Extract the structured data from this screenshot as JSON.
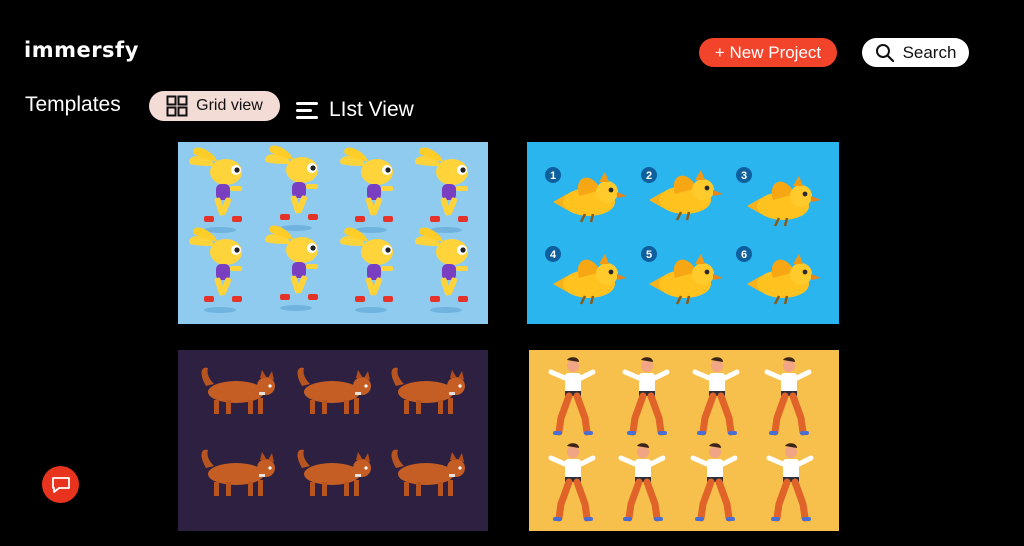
{
  "header": {
    "logo_text": "immersfy",
    "new_project_label": "+ New Project",
    "search_label": "Search"
  },
  "toolbar": {
    "section_title": "Templates",
    "grid_view_label": "Grid view",
    "list_view_label": "LIst View"
  },
  "templates": [
    {
      "name": "yellow-rabbit-run-cycle",
      "background": "#8ecbef"
    },
    {
      "name": "flying-bird-sequence",
      "background": "#2ab5ef",
      "frame_numbers": [
        "1",
        "2",
        "3",
        "4",
        "5",
        "6"
      ]
    },
    {
      "name": "cat-walk-cycle",
      "background": "#2d2040"
    },
    {
      "name": "martial-arts-poses",
      "background": "#f7bf4b"
    }
  ],
  "colors": {
    "accent": "#f2442a",
    "grid_view_bg": "#f4dcd6",
    "chat_button": "#e8341f"
  },
  "icons": {
    "search": "search-icon",
    "grid": "grid-icon",
    "list": "list-icon",
    "chat": "chat-icon"
  }
}
